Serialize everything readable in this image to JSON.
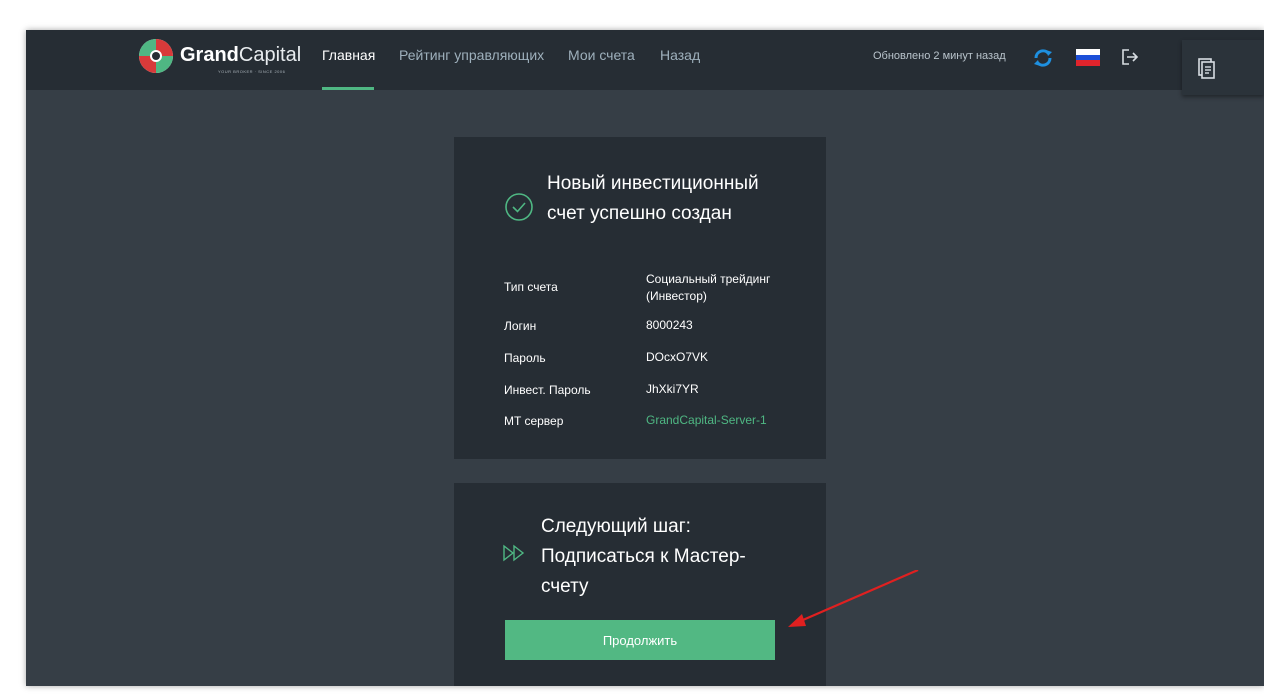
{
  "header": {
    "logo": {
      "brand_bold": "Grand",
      "brand_light": "Capital",
      "tagline": "YOUR BROKER · SINCE 2006"
    },
    "nav": [
      {
        "label": "Главная",
        "active": true
      },
      {
        "label": "Рейтинг управляющих",
        "active": false
      },
      {
        "label": "Мои счета",
        "active": false
      },
      {
        "label": "Назад",
        "active": false
      }
    ],
    "updated_text": "Обновлено 2 минут назад",
    "icons": {
      "refresh": "refresh-icon",
      "language": "russian-flag-icon",
      "logout": "logout-icon",
      "side": "document-icon"
    }
  },
  "account_card": {
    "title": "Новый инвестиционный счет успешно создан",
    "icon": "check-circle-icon",
    "rows": [
      {
        "label": "Тип счета",
        "value": "Социальный трейдинг (Инвестор)"
      },
      {
        "label": "Логин",
        "value": "8000243"
      },
      {
        "label": "Пароль",
        "value": "DOcxO7VK"
      },
      {
        "label": "Инвест. Пароль",
        "value": "JhXki7YR"
      },
      {
        "label": "MT сервер",
        "value": "GrandCapital-Server-1"
      }
    ]
  },
  "next_step_card": {
    "title": "Следующий шаг: Подписаться к Мастер-счету",
    "icon": "fast-forward-icon",
    "button_label": "Продолжить"
  },
  "colors": {
    "accent": "#52b883",
    "header_bg": "#262d34",
    "page_bg": "#363e46",
    "card_bg": "#262d34",
    "annotation_arrow": "#e02020"
  }
}
